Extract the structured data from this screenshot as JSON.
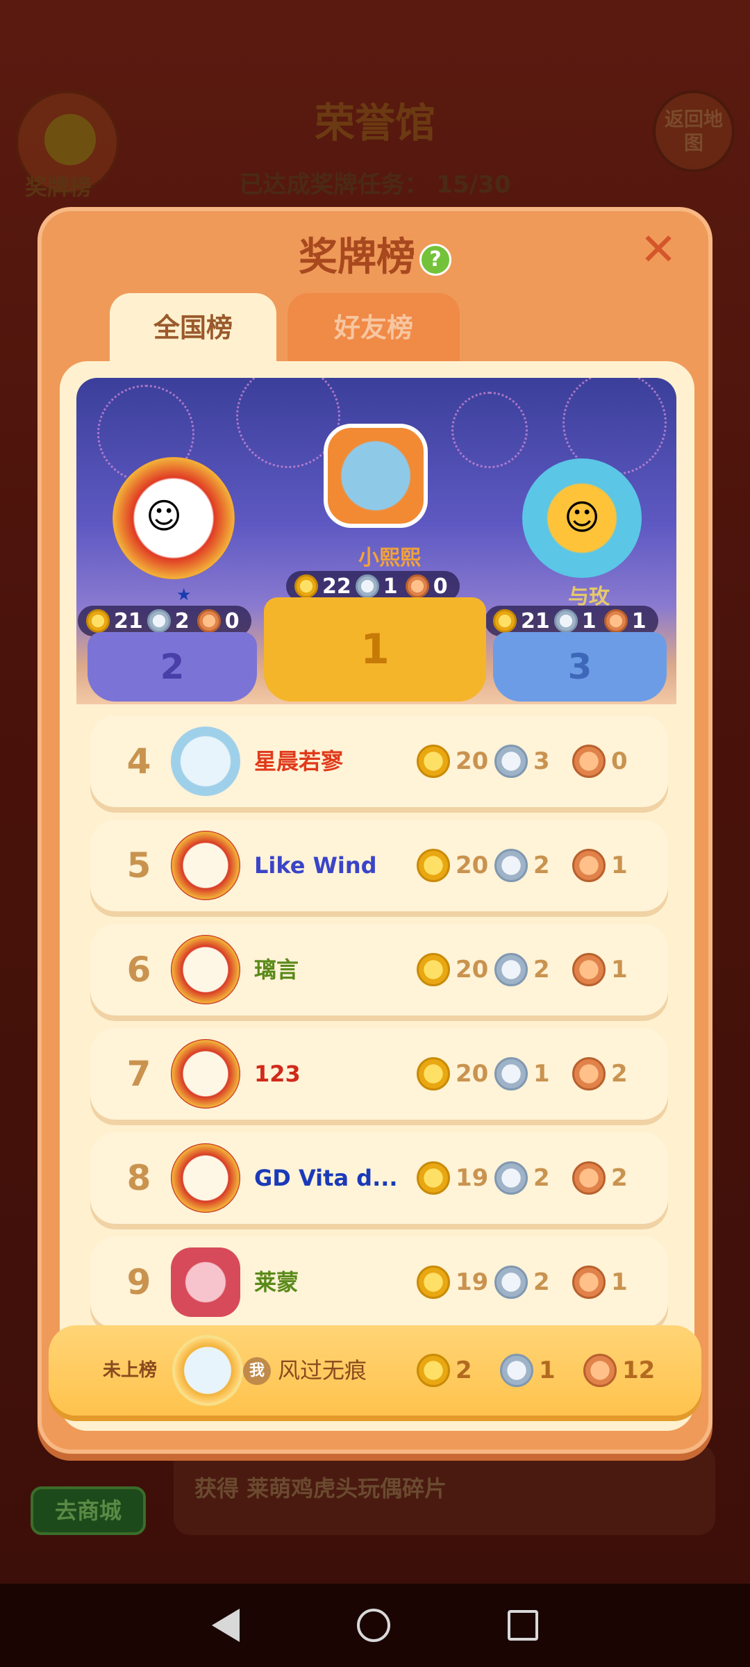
{
  "background": {
    "title": "荣誉馆",
    "progress_label": "已达成奖牌任务：",
    "progress_value": "15/30",
    "left_button_label": "奖牌榜",
    "right_button_label": "返回地图",
    "bottom_reward_text": "获得 莱萌鸡虎头玩偶碎片",
    "shop_button_label": "去商城"
  },
  "modal": {
    "title": "奖牌榜",
    "tabs": [
      {
        "label": "全国榜",
        "active": true
      },
      {
        "label": "好友榜",
        "active": false
      }
    ]
  },
  "podium": {
    "first": {
      "rank": "1",
      "name": "小熙熙",
      "gold": "22",
      "silver": "1",
      "bronze": "0"
    },
    "second": {
      "rank": "2",
      "name": "",
      "gold": "21",
      "silver": "2",
      "bronze": "0"
    },
    "third": {
      "rank": "3",
      "name": "与玫",
      "gold": "21",
      "silver": "1",
      "bronze": "1"
    }
  },
  "rows": [
    {
      "rank": "4",
      "name": "星晨若寥",
      "gold": "20",
      "silver": "3",
      "bronze": "0",
      "color": "#e03a1a"
    },
    {
      "rank": "5",
      "name": "Like Wind",
      "gold": "20",
      "silver": "2",
      "bronze": "1",
      "color": "#3a44c8"
    },
    {
      "rank": "6",
      "name": "璃言",
      "gold": "20",
      "silver": "2",
      "bronze": "1",
      "color": "#5a8a1a"
    },
    {
      "rank": "7",
      "name": "123",
      "gold": "20",
      "silver": "1",
      "bronze": "2",
      "color": "#d02a1a"
    },
    {
      "rank": "8",
      "name": "GD Vita d...",
      "gold": "19",
      "silver": "2",
      "bronze": "2",
      "color": "#1a3ab8"
    },
    {
      "rank": "9",
      "name": "莱蒙",
      "gold": "19",
      "silver": "2",
      "bronze": "1",
      "color": "#5a8a1a"
    }
  ],
  "self": {
    "rank_label": "未上榜",
    "me_badge": "我",
    "name": "风过无痕",
    "gold": "2",
    "silver": "1",
    "bronze": "12"
  },
  "navbar": {
    "back": "back-icon",
    "home": "home-icon",
    "recent": "recent-apps-icon"
  }
}
